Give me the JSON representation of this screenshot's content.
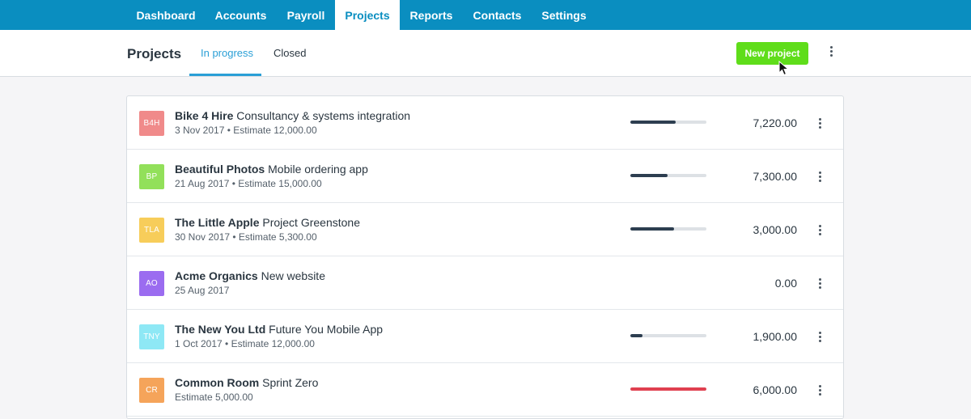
{
  "topnav": {
    "tabs": [
      {
        "label": "Dashboard",
        "active": false
      },
      {
        "label": "Accounts",
        "active": false
      },
      {
        "label": "Payroll",
        "active": false
      },
      {
        "label": "Projects",
        "active": true
      },
      {
        "label": "Reports",
        "active": false
      },
      {
        "label": "Contacts",
        "active": false
      },
      {
        "label": "Settings",
        "active": false
      }
    ]
  },
  "subheader": {
    "title": "Projects",
    "tabs": [
      {
        "label": "In progress",
        "active": true
      },
      {
        "label": "Closed",
        "active": false
      }
    ],
    "new_button": "New project"
  },
  "colors": {
    "nav": "#0a8ec0",
    "accent": "#2a9fd6",
    "button": "#5fdd1a",
    "progress_normal": "#2d3e50",
    "progress_over": "#e04050"
  },
  "projects": [
    {
      "initials": "B4H",
      "avatar_color": "#f08a8a",
      "client": "Bike 4 Hire",
      "name": "Consultancy & systems integration",
      "meta": "3 Nov 2017  •  Estimate 12,000.00",
      "progress": 0.6,
      "over_budget": false,
      "amount": "7,220.00",
      "show_progress": true
    },
    {
      "initials": "BP",
      "avatar_color": "#92e05a",
      "client": "Beautiful Photos",
      "name": "Mobile ordering app",
      "meta": "21 Aug 2017  •  Estimate 15,000.00",
      "progress": 0.49,
      "over_budget": false,
      "amount": "7,300.00",
      "show_progress": true
    },
    {
      "initials": "TLA",
      "avatar_color": "#f7cd5a",
      "client": "The Little Apple",
      "name": "Project Greenstone",
      "meta": "30 Nov 2017  •  Estimate 5,300.00",
      "progress": 0.57,
      "over_budget": false,
      "amount": "3,000.00",
      "show_progress": true
    },
    {
      "initials": "AO",
      "avatar_color": "#9b6cf0",
      "client": "Acme Organics",
      "name": "New website",
      "meta": "25 Aug 2017",
      "progress": 0,
      "over_budget": false,
      "amount": "0.00",
      "show_progress": false
    },
    {
      "initials": "TNY",
      "avatar_color": "#8ee8f5",
      "client": "The New You Ltd",
      "name": "Future You Mobile App",
      "meta": "1 Oct 2017  •  Estimate 12,000.00",
      "progress": 0.16,
      "over_budget": false,
      "amount": "1,900.00",
      "show_progress": true
    },
    {
      "initials": "CR",
      "avatar_color": "#f5a45a",
      "client": "Common Room",
      "name": "Sprint Zero",
      "meta": "Estimate 5,000.00",
      "progress": 1.0,
      "over_budget": true,
      "amount": "6,000.00",
      "show_progress": true
    }
  ]
}
